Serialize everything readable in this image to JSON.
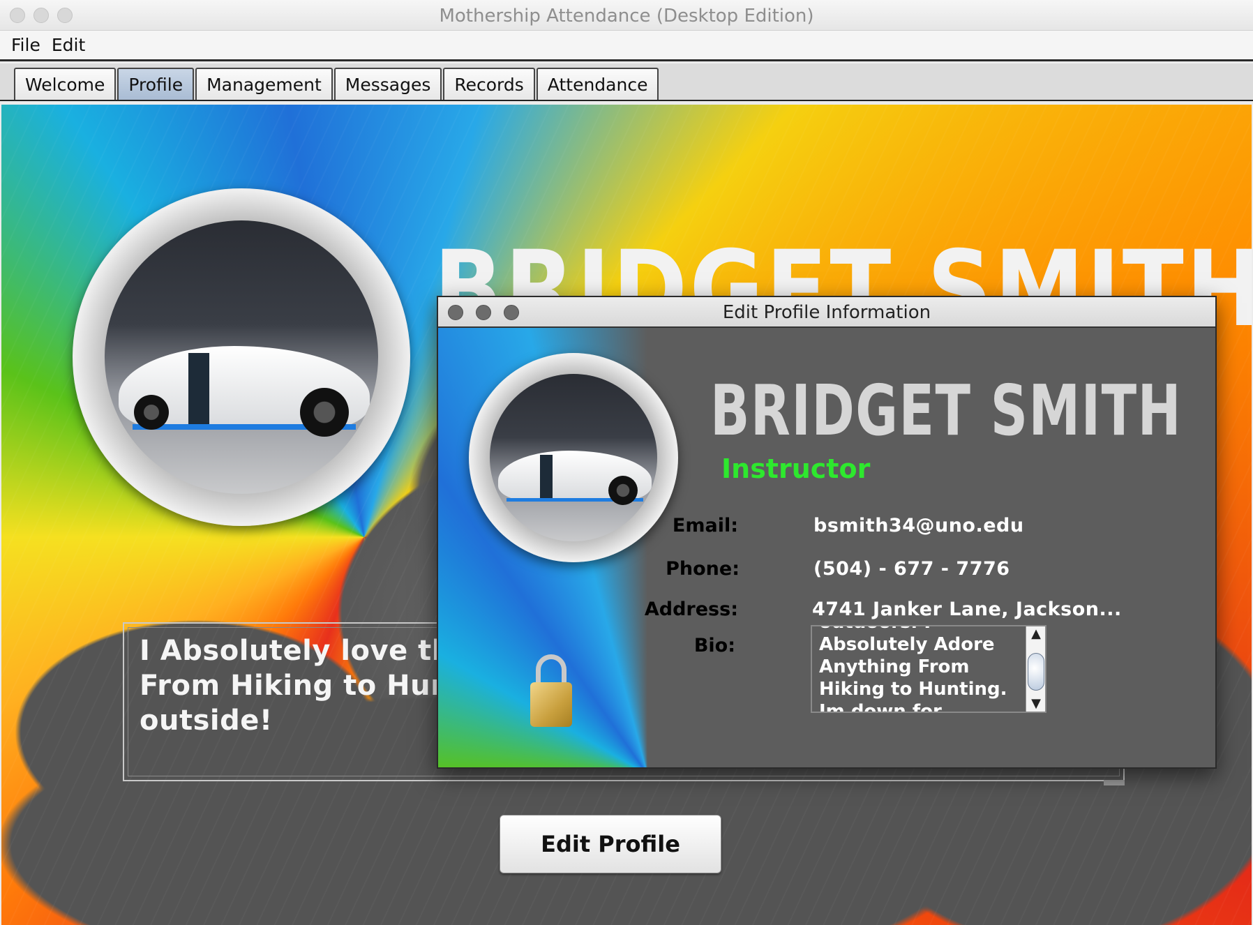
{
  "window": {
    "title": "Mothership Attendance (Desktop Edition)"
  },
  "menu": {
    "file": "File",
    "edit": "Edit"
  },
  "tabs": [
    {
      "label": "Welcome"
    },
    {
      "label": "Profile"
    },
    {
      "label": "Management"
    },
    {
      "label": "Messages"
    },
    {
      "label": "Records"
    },
    {
      "label": "Attendance"
    }
  ],
  "active_tab": "Profile",
  "profile": {
    "name": "BRIDGET SMITH",
    "bio": "I Absolutely love the From Hiking to Hunt outside!",
    "bio_lines": [
      "I Absolutely love the",
      "From Hiking to Hunt",
      "outside!"
    ],
    "edit_button": "Edit Profile"
  },
  "dialog": {
    "title": "Edit Profile Information",
    "name": "BRIDGET SMITH",
    "role": "Instructor",
    "fields": {
      "email_label": "Email:",
      "email_value": "bsmith34@uno.edu",
      "phone_label": "Phone:",
      "phone_value": "(504) - 677 - 7776",
      "address_label": "Address:",
      "address_value": "4741 Janker Lane, Jackson...",
      "bio_label": "Bio:",
      "bio_value": "outdoors. I Absolutely Adore Anything From Hiking to Hunting. Im down for whatever so long as I'm outside!"
    }
  },
  "colors": {
    "role_green": "#2ee82e",
    "active_tab": "#b9c9dd"
  },
  "icons": {
    "lock": "lock-icon"
  }
}
